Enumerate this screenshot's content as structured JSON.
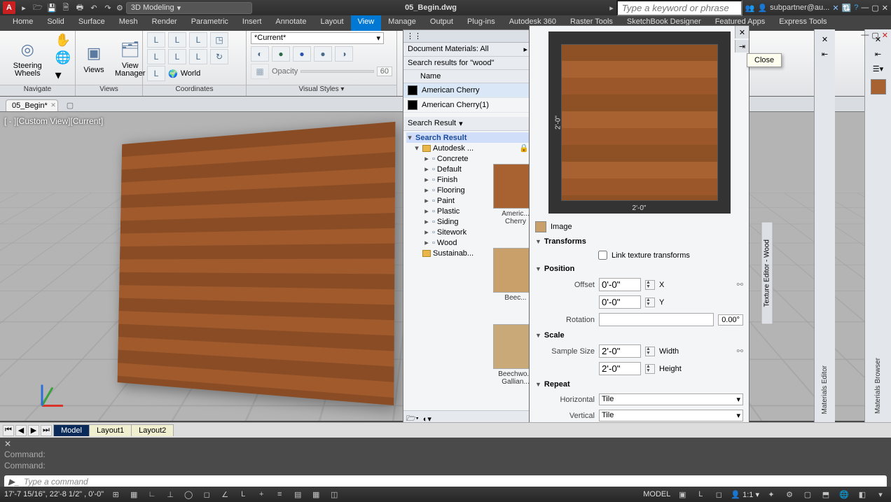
{
  "title": "05_Begin.dwg",
  "workspace": "3D Modeling",
  "search_placeholder": "Type a keyword or phrase",
  "user": "subpartner@au...",
  "menu": [
    "Home",
    "Solid",
    "Surface",
    "Mesh",
    "Render",
    "Parametric",
    "Insert",
    "Annotate",
    "Layout",
    "View",
    "Manage",
    "Output",
    "Plug-ins",
    "Autodesk 360",
    "Raster Tools",
    "SketchBook Designer",
    "Featured Apps",
    "Express Tools"
  ],
  "active_menu": "View",
  "ribbon": {
    "navigate": {
      "steering": "Steering\nWheels",
      "label": "Navigate"
    },
    "views": {
      "views": "Views",
      "mgr": "View\nManager",
      "label": "Views"
    },
    "coords": {
      "label": "Coordinates",
      "world": "World"
    },
    "visual": {
      "current": "*Current*",
      "opacity": "Opacity",
      "opacity_val": "60",
      "label": "Visual Styles"
    }
  },
  "doctab": "05_Begin*",
  "viewport_label": "[ - ][Custom View][Current]",
  "mat_browser": {
    "doc_header": "Document Materials: All",
    "search_res": "Search results for \"wood\"",
    "col_name": "Name",
    "items": [
      {
        "name": "American Cherry",
        "sel": true
      },
      {
        "name": "American Cherry(1)",
        "sel": false
      }
    ],
    "sr_tab": "Search Result",
    "tree_root": "Search Result",
    "tree_lib": "Autodesk ...",
    "tree_items": [
      "Concrete",
      "Default",
      "Finish",
      "Flooring",
      "Paint",
      "Plastic",
      "Siding",
      "Sitework",
      "Wood"
    ],
    "tree_sust": "Sustainab...",
    "thumbs": [
      {
        "label": "Americ...\nCherry",
        "bg": "#a86232"
      },
      {
        "label": "Beec...",
        "bg": "#c9a06a"
      },
      {
        "label": "Beechwo...\nGallian...",
        "bg": "#caa978"
      }
    ]
  },
  "tex_editor": {
    "title": "Texture Editor - Wood",
    "close_tip": "Close",
    "dim_h": "2'-0\"",
    "dim_v": "2'-0\"",
    "image_label": "Image",
    "sec_transforms": "Transforms",
    "link_tex": "Link texture transforms",
    "sec_position": "Position",
    "offset_label": "Offset",
    "offset_x": "0'-0\"",
    "axis_x": "X",
    "offset_y": "0'-0\"",
    "axis_y": "Y",
    "rotation_label": "Rotation",
    "rotation_val": "0.00°",
    "sec_scale": "Scale",
    "sample_label": "Sample Size",
    "scale_w": "2'-0\"",
    "width_l": "Width",
    "scale_h": "2'-0\"",
    "height_l": "Height",
    "sec_repeat": "Repeat",
    "rep_h_label": "Horizontal",
    "rep_h": "Tile",
    "rep_v_label": "Vertical",
    "rep_v": "Tile"
  },
  "materials_editor_tab": "Materials Editor",
  "materials_browser_tab": "Materials Browser",
  "layout_tabs": [
    "Model",
    "Layout1",
    "Layout2"
  ],
  "cmd_hist": [
    "Command:",
    "Command:"
  ],
  "cmd_placeholder": "Type a command",
  "status": {
    "coords": "17'-7 15/16\", 22'-8 1/2\" , 0'-0\"",
    "model": "MODEL",
    "scale": "1:1"
  }
}
